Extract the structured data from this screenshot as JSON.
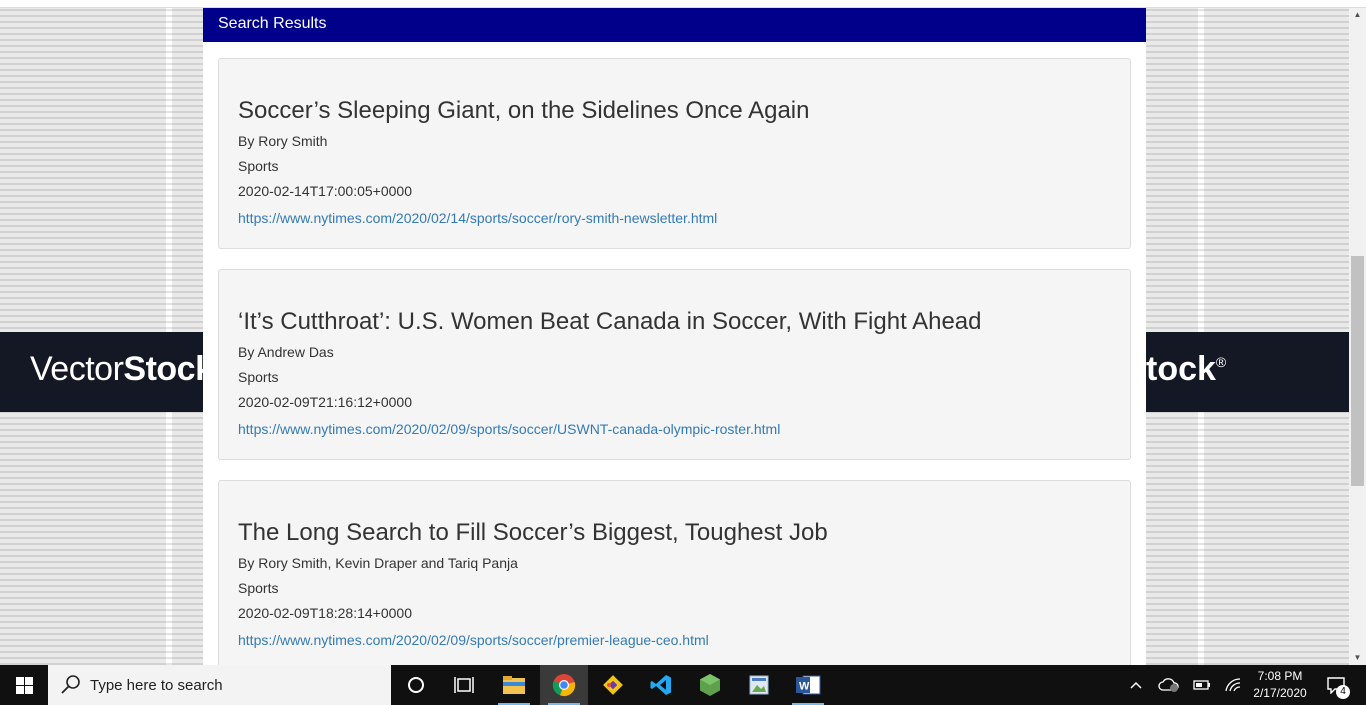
{
  "background": {
    "brand_left_regular": "Vector",
    "brand_left_bold": "Stock",
    "brand_right": "tock",
    "brand_right_mark": "®"
  },
  "panel": {
    "header": "Search Results"
  },
  "results": [
    {
      "title": "Soccer’s Sleeping Giant, on the Sidelines Once Again",
      "byline": "By Rory Smith",
      "section": "Sports",
      "date": "2020-02-14T17:00:05+0000",
      "url": "https://www.nytimes.com/2020/02/14/sports/soccer/rory-smith-newsletter.html"
    },
    {
      "title": "‘It’s Cutthroat’: U.S. Women Beat Canada in Soccer, With Fight Ahead",
      "byline": "By Andrew Das",
      "section": "Sports",
      "date": "2020-02-09T21:16:12+0000",
      "url": "https://www.nytimes.com/2020/02/09/sports/soccer/USWNT-canada-olympic-roster.html"
    },
    {
      "title": "The Long Search to Fill Soccer’s Biggest, Toughest Job",
      "byline": "By Rory Smith, Kevin Draper and Tariq Panja",
      "section": "Sports",
      "date": "2020-02-09T18:28:14+0000",
      "url": "https://www.nytimes.com/2020/02/09/sports/soccer/premier-league-ceo.html"
    }
  ],
  "taskbar": {
    "search_placeholder": "Type here to search",
    "time": "7:08 PM",
    "date": "2/17/2020",
    "notification_count": "4",
    "pinned": [
      "cortana-icon",
      "task-view-icon",
      "file-explorer-icon",
      "chrome-icon",
      "git-icon",
      "vscode-icon",
      "nodejs-icon",
      "photos-icon",
      "word-icon"
    ]
  },
  "colors": {
    "header_bg": "#00008b",
    "link": "#337ab7",
    "card_bg": "#f5f5f5",
    "taskbar_bg": "#101010"
  }
}
